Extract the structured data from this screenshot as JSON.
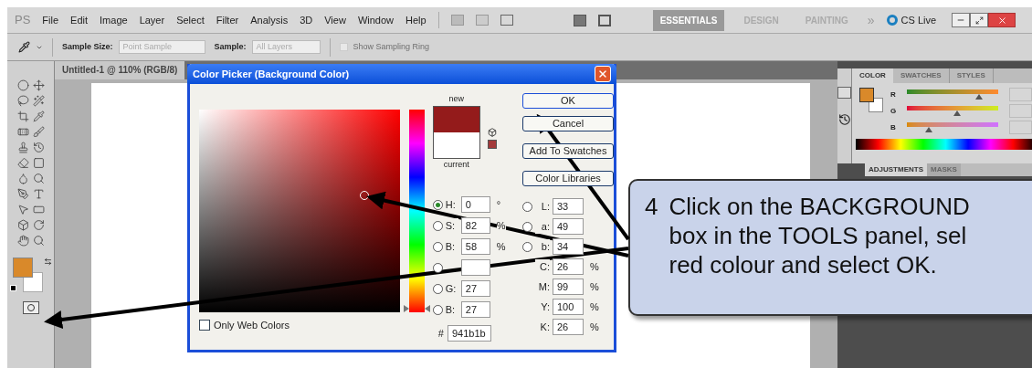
{
  "menu_bar": {
    "logo": "PS",
    "items": [
      "File",
      "Edit",
      "Image",
      "Layer",
      "Select",
      "Filter",
      "Analysis",
      "3D",
      "View",
      "Window",
      "Help"
    ],
    "workspaces": [
      {
        "label": "ESSENTIALS",
        "selected": true
      },
      {
        "label": "DESIGN",
        "selected": false
      },
      {
        "label": "PAINTING",
        "selected": false
      }
    ],
    "more": "»",
    "cs_live": "CS Live"
  },
  "options_bar": {
    "sample_size": {
      "label": "Sample Size:",
      "value": "Point Sample"
    },
    "sample": {
      "label": "Sample:",
      "value": "All Layers"
    },
    "sampling_ring": {
      "label": "Show Sampling Ring",
      "checked": false,
      "disabled": true
    }
  },
  "document": {
    "tab": "Untitled-1 @ 110% (RGB/8)"
  },
  "dialog": {
    "title": "Color Picker (Background Color)",
    "new_label": "new",
    "current_label": "current",
    "buttons": [
      "OK",
      "Cancel",
      "Add To Swatches",
      "Color Libraries"
    ],
    "left_fields": [
      {
        "label": "H:",
        "value": "0",
        "unit": "°",
        "selected": true
      },
      {
        "label": "S:",
        "value": "82",
        "unit": "%",
        "selected": false
      },
      {
        "label": "B:",
        "value": "58",
        "unit": "%",
        "selected": false
      },
      {
        "selected": false
      },
      {
        "label": "G:",
        "value": "27",
        "selected": false
      },
      {
        "label": "B:",
        "value": "27",
        "selected": false
      }
    ],
    "right_fields": [
      {
        "kind": "radio",
        "label": "L:",
        "value": "33",
        "selected": false
      },
      {
        "kind": "radio",
        "label": "a:",
        "value": "49",
        "selected": false
      },
      {
        "kind": "radio",
        "label": "b:",
        "value": "34",
        "selected": false
      },
      {
        "kind": "plain",
        "label": "C:",
        "value": "26",
        "unit": "%"
      },
      {
        "kind": "plain",
        "label": "M:",
        "value": "99",
        "unit": "%"
      },
      {
        "kind": "plain",
        "label": "Y:",
        "value": "100",
        "unit": "%"
      },
      {
        "kind": "plain",
        "label": "K:",
        "value": "26",
        "unit": "%"
      }
    ],
    "hex_label": "#",
    "hex": "941b1b",
    "web_colors": {
      "label": "Only Web Colors",
      "checked": false
    }
  },
  "panel": {
    "tabs": [
      {
        "label": "COLOR",
        "selected": true
      },
      {
        "label": "SWATCHES",
        "selected": false
      },
      {
        "label": "STYLES",
        "selected": false
      }
    ],
    "sliders": [
      {
        "label": "R",
        "level": 0.82
      },
      {
        "label": "G",
        "level": 0.55
      },
      {
        "label": "B",
        "level": 0.22
      }
    ],
    "lower_tabs": [
      {
        "label": "ADJUSTMENTS",
        "selected": true
      },
      {
        "label": "MASKS",
        "selected": false
      }
    ]
  },
  "callout": {
    "step": "4",
    "lines": [
      "Click on the BACKGROUND",
      "box in the TOOLS panel, sel",
      "red colour and select OK."
    ]
  }
}
